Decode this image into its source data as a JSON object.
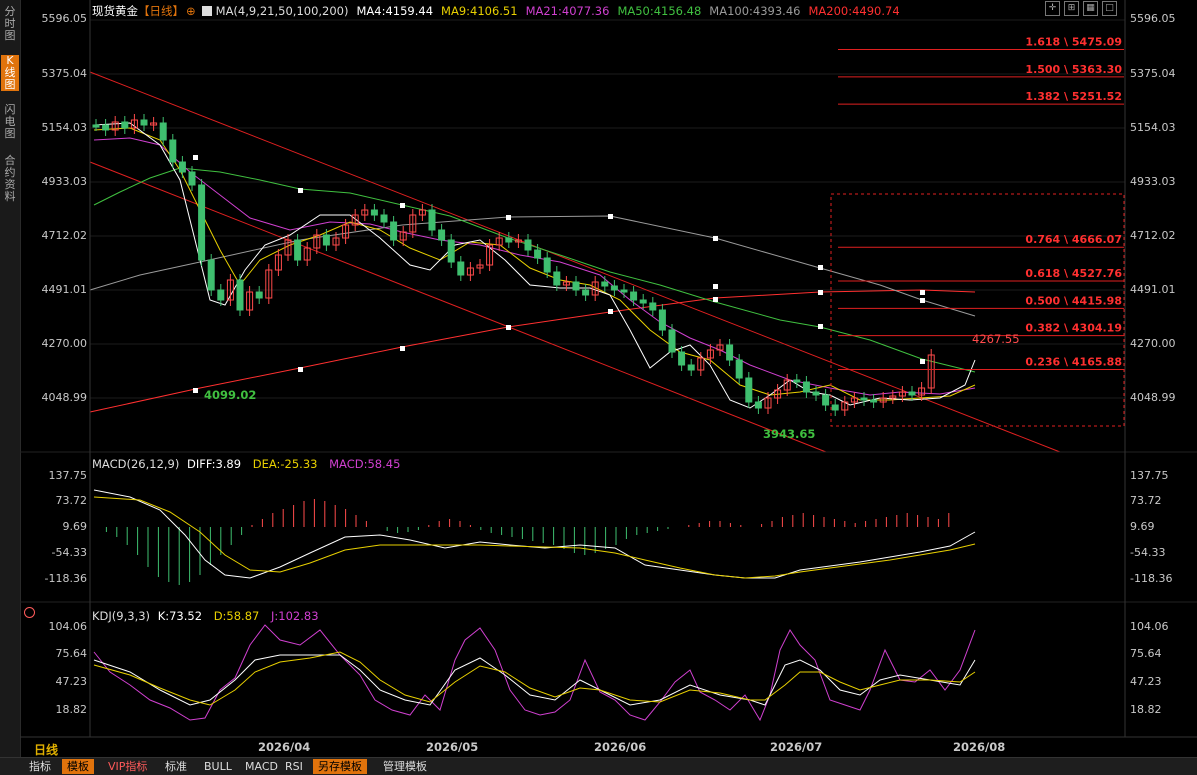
{
  "sidebar": {
    "tabs": [
      {
        "label": "分时图",
        "active": false
      },
      {
        "label": "K线图",
        "active": true
      },
      {
        "label": "闪电图",
        "active": false
      },
      {
        "label": "合约资料",
        "active": false
      }
    ]
  },
  "header": {
    "title": "现货黄金",
    "period_tag": "【日线】",
    "ma_params": "MA(4,9,21,50,100,200)",
    "ma4": "MA4:4159.44",
    "ma9": "MA9:4106.51",
    "ma21": "MA21:4077.36",
    "ma50": "MA50:4156.48",
    "ma100": "MA100:4393.46",
    "ma200": "MA200:4490.74"
  },
  "colors": {
    "up": "#ff4b4b",
    "down": "#3fbf6f",
    "ma4": "#ffffff",
    "ma9": "#e8d000",
    "ma21": "#d040d0",
    "ma50": "#40c040",
    "ma100": "#9a9a9a",
    "ma200": "#ff3030",
    "accent": "#e0730c"
  },
  "price_axis": {
    "labels": [
      "5596.05",
      "5375.04",
      "5154.03",
      "4933.03",
      "4712.02",
      "4491.01",
      "4270.00",
      "4048.99"
    ]
  },
  "fib_levels": [
    {
      "label": "1.618 \\ 5475.09",
      "value": 5475.09
    },
    {
      "label": "1.500 \\ 5363.30",
      "value": 5363.3
    },
    {
      "label": "1.382 \\ 5251.52",
      "value": 5251.52
    },
    {
      "label": "0.764 \\ 4666.07",
      "value": 4666.07
    },
    {
      "label": "0.618 \\ 4527.76",
      "value": 4527.76
    },
    {
      "label": "0.500 \\ 4415.98",
      "value": 4415.98
    },
    {
      "label": "0.382 \\ 4304.19",
      "value": 4304.19
    },
    {
      "label": "0.236 \\ 4165.88",
      "value": 4165.88
    }
  ],
  "annotations": {
    "low1": "4099.02",
    "low2": "3943.65",
    "high_last": "4267.55"
  },
  "macd": {
    "title": "MACD(26,12,9)",
    "diff": "DIFF:3.89",
    "dea": "DEA:-25.33",
    "macd": "MACD:58.45",
    "axis": [
      "137.75",
      "73.72",
      "9.69",
      "-54.33",
      "-118.36"
    ]
  },
  "kdj": {
    "title": "KDJ(9,3,3)",
    "k": "K:73.52",
    "d": "D:58.87",
    "j": "J:102.83",
    "axis": [
      "104.06",
      "75.64",
      "47.23",
      "18.82"
    ]
  },
  "dates": [
    "2026/04",
    "2026/05",
    "2026/06",
    "2026/07",
    "2026/08"
  ],
  "period_label": "日线",
  "bottom_tabs": [
    "指标",
    "模板",
    "VIP指标",
    "标准",
    "BULL",
    "MACD",
    "RSI",
    "另存模板",
    "管理模板"
  ]
}
